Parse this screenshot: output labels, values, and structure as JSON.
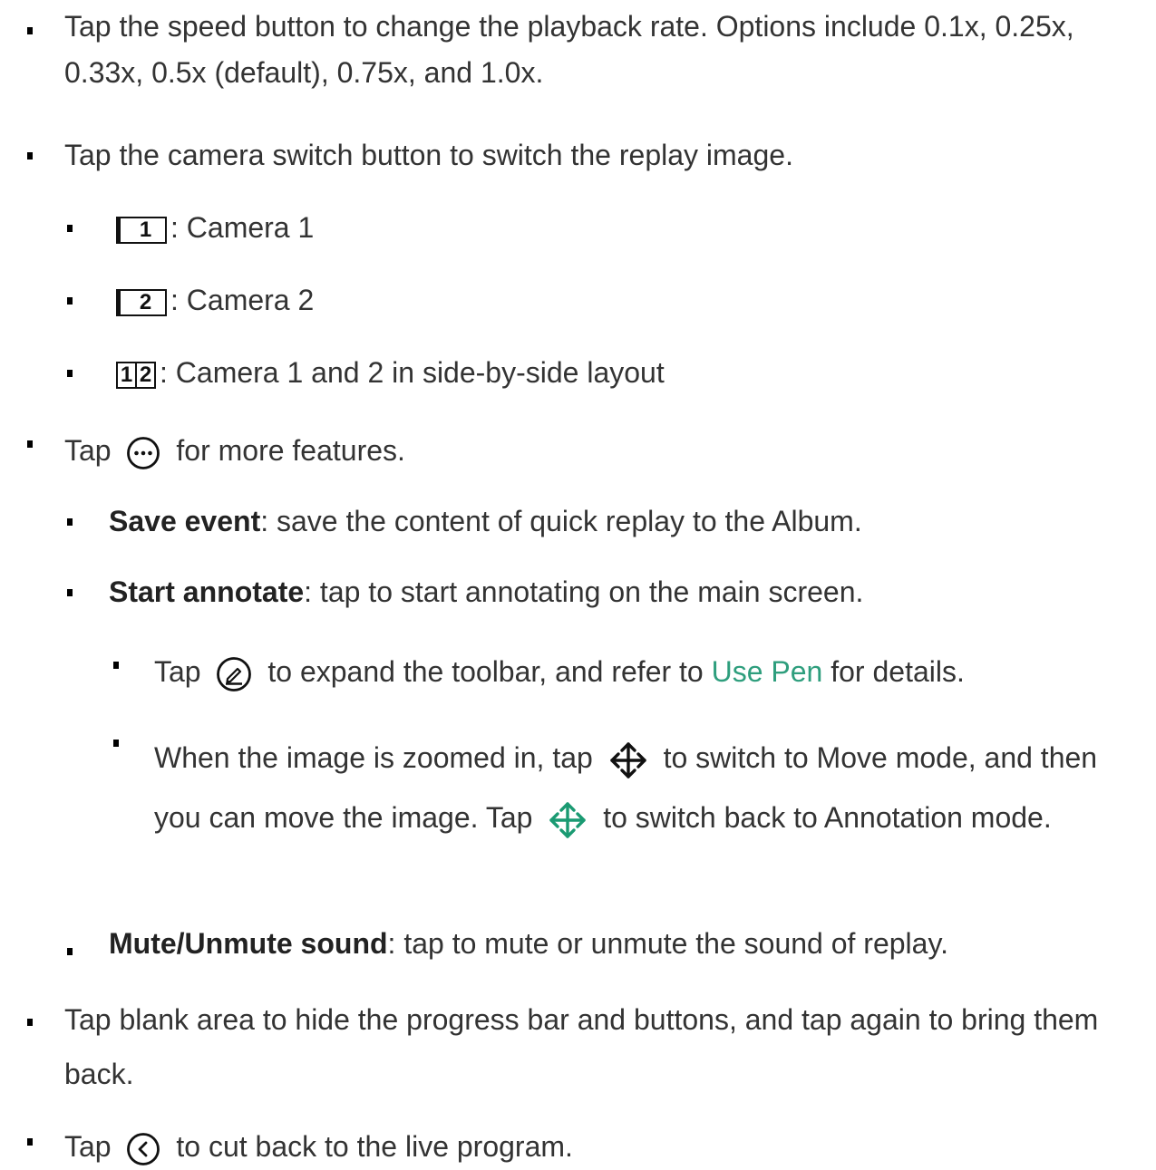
{
  "items": {
    "speed": "Tap the speed button to change the playback rate. Options include 0.1x, 0.25x, 0.33x, 0.5x (default), 0.75x, and 1.0x.",
    "camera_switch": "Tap the camera switch button to switch the replay image.",
    "cam1_icon": "1",
    "cam1_text": ": Camera 1",
    "cam2_icon": "2",
    "cam2_text": ": Camera 2",
    "dual_icon_a": "1",
    "dual_icon_b": "2",
    "dual_text": ": Camera 1 and 2 in side-by-side layout",
    "more_prefix": "Tap",
    "more_suffix": "for more features.",
    "save_term": "Save event",
    "save_text": ": save the content of quick replay to the Album.",
    "annotate_term": "Start annotate",
    "annotate_text": ": tap to start annotating on the main screen.",
    "pen_prefix": "Tap",
    "pen_middle": "to expand the toolbar, and refer to",
    "pen_link": "Use Pen",
    "pen_suffix": "for details.",
    "move_a": "When the image is zoomed in, tap",
    "move_b": "to switch to Move mode, and then you can move the image. Tap",
    "move_c": "to switch back to Annotation mode.",
    "mute_term": "Mute/Unmute sound",
    "mute_text": ": tap to mute or unmute the sound of replay.",
    "blank": "Tap blank area to hide the progress bar and buttons, and tap again to bring them back.",
    "back_prefix": "Tap",
    "back_suffix": "to cut back to the live program."
  },
  "icons": [
    "more-icon",
    "pen-icon",
    "move-icon",
    "move-active-icon",
    "back-icon"
  ],
  "colors": {
    "text": "#333333",
    "link": "#2e9e7d",
    "accent_icon": "#1a9a72"
  }
}
